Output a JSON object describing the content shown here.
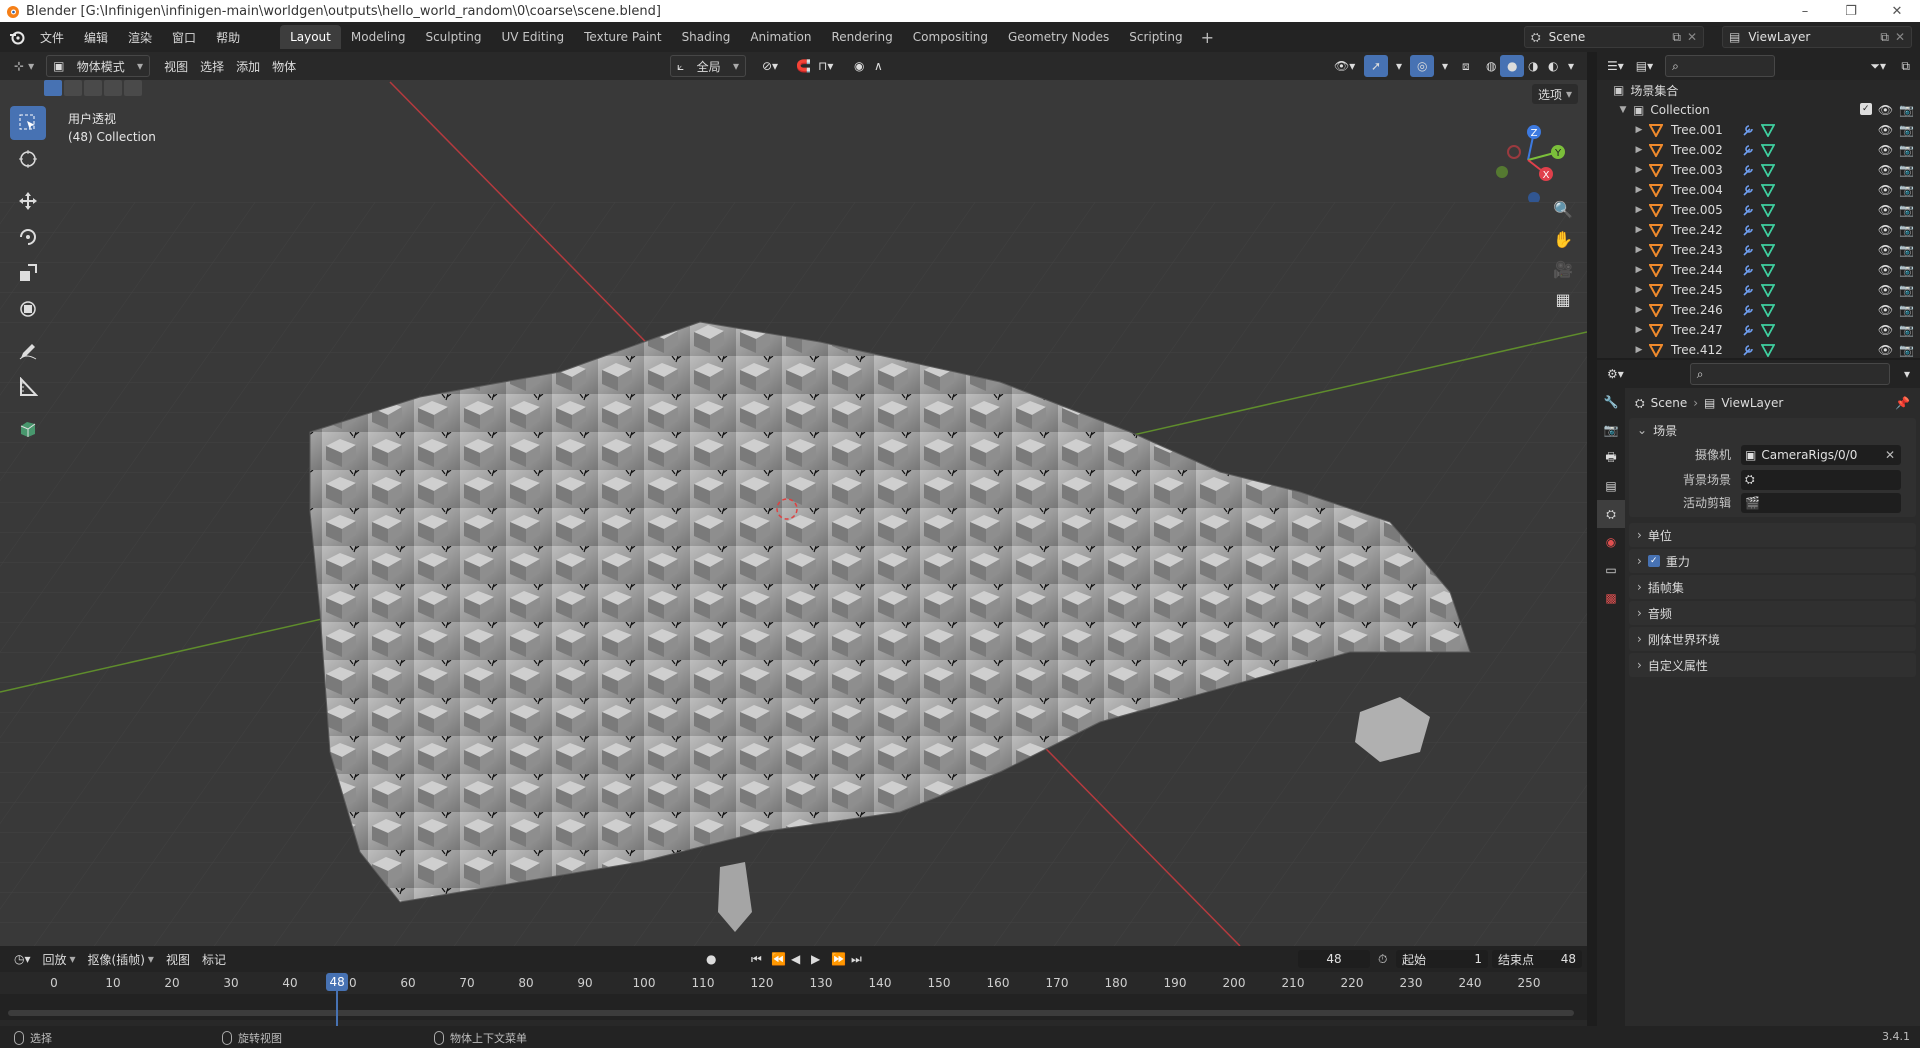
{
  "window": {
    "title": "Blender [G:\\Infinigen\\infinigen-main\\worldgen\\outputs\\hello_world_random\\0\\coarse\\scene.blend]",
    "minimize": "–",
    "maximize": "❐",
    "close": "✕"
  },
  "menubar": {
    "menus": [
      "文件",
      "编辑",
      "渲染",
      "窗口",
      "帮助"
    ],
    "workspaces": [
      "Layout",
      "Modeling",
      "Sculpting",
      "UV Editing",
      "Texture Paint",
      "Shading",
      "Animation",
      "Rendering",
      "Compositing",
      "Geometry Nodes",
      "Scripting"
    ],
    "active_workspace": "Layout",
    "add_tab": "+",
    "scene": "Scene",
    "view_layer": "ViewLayer"
  },
  "viewport": {
    "mode": "物体模式",
    "menus": [
      "视图",
      "选择",
      "添加",
      "物体"
    ],
    "transform_orientation": "全局",
    "options_label": "选项",
    "view_name": "用户透视",
    "collection_info": "(48) Collection",
    "gizmo": {
      "x": "X",
      "y": "Y",
      "z": "Z"
    },
    "colors": {
      "x_axis": "#e0404b",
      "y_axis": "#7bbf3a",
      "z_axis": "#3d7ae0",
      "active": "#4772b3"
    }
  },
  "outliner": {
    "root": "场景集合",
    "collection": "Collection",
    "items": [
      "Tree.001",
      "Tree.002",
      "Tree.003",
      "Tree.004",
      "Tree.005",
      "Tree.242",
      "Tree.243",
      "Tree.244",
      "Tree.245",
      "Tree.246",
      "Tree.247",
      "Tree.412"
    ]
  },
  "properties": {
    "breadcrumb_scene": "Scene",
    "breadcrumb_viewlayer": "ViewLayer",
    "scene_panel": "场景",
    "fields": [
      {
        "label": "摄像机",
        "value": "CameraRigs/0/0"
      },
      {
        "label": "背景场景",
        "value": ""
      },
      {
        "label": "活动剪辑",
        "value": ""
      }
    ],
    "panels": [
      "单位",
      "重力",
      "插帧集",
      "音频",
      "刚体世界环境",
      "自定义属性"
    ],
    "gravity_checked": true
  },
  "timeline": {
    "menus": [
      "回放",
      "抠像(插帧)",
      "视图",
      "标记"
    ],
    "current_frame": "48",
    "start_label": "起始",
    "start": "1",
    "end_label": "结束点",
    "end": "48",
    "ticks": [
      "0",
      "10",
      "20",
      "30",
      "40",
      "50",
      "60",
      "70",
      "80",
      "90",
      "100",
      "110",
      "120",
      "130",
      "140",
      "150",
      "160",
      "170",
      "180",
      "190",
      "200",
      "210",
      "220",
      "230",
      "240",
      "250"
    ],
    "ticks_values": [
      0,
      10,
      20,
      30,
      40,
      50,
      60,
      70,
      80,
      90,
      100,
      110,
      120,
      130,
      140,
      150,
      160,
      170,
      180,
      190,
      200,
      210,
      220,
      230,
      240,
      250
    ]
  },
  "statusbar": {
    "select": "选择",
    "rotate": "旋转视图",
    "context": "物体上下文菜单",
    "version": "3.4.1"
  }
}
